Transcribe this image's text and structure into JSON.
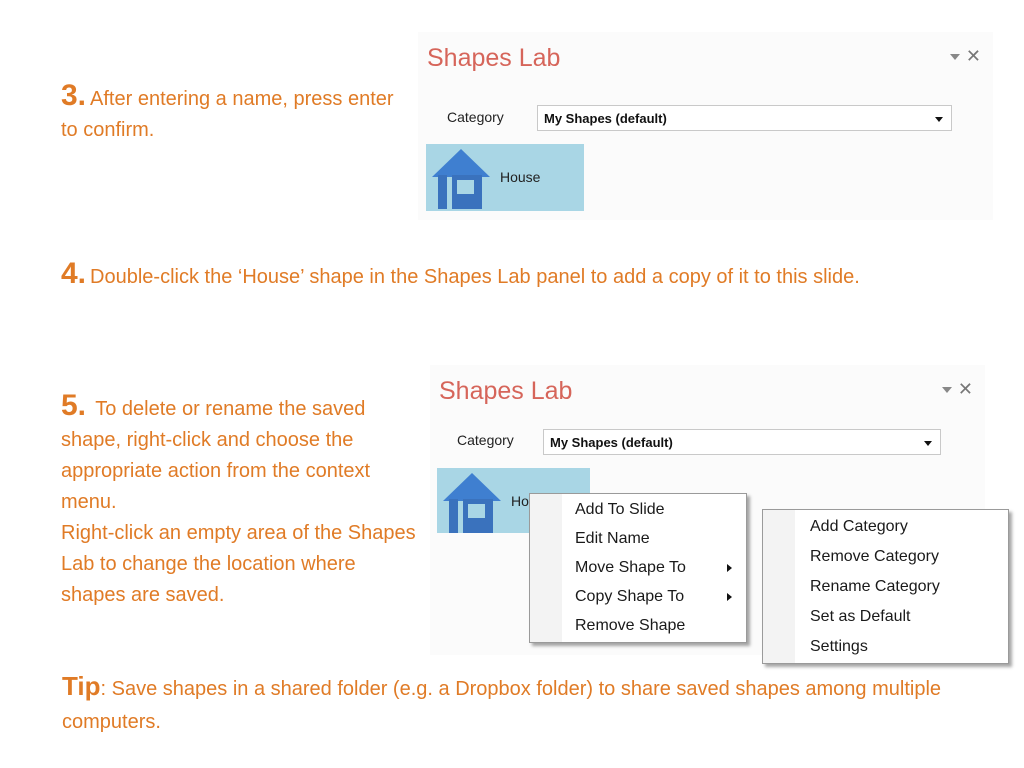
{
  "steps": {
    "step3": {
      "number": "3.",
      "text": "After entering a name, press enter to confirm."
    },
    "step4": {
      "number": "4.",
      "text": "Double-click the ‘House’ shape in the Shapes Lab panel to add a copy of it to this slide."
    },
    "step5": {
      "number": "5.",
      "text": " To delete or rename the saved shape, right-click and choose the appropriate action from the context menu.",
      "text2": "Right-click an empty area of the Shapes Lab to change the location where shapes are saved."
    }
  },
  "tip": {
    "label": "Tip",
    "text": ": Save shapes in a shared folder (e.g. a Dropbox folder) to share saved shapes among multiple computers."
  },
  "panel": {
    "title": "Shapes Lab",
    "category_label": "Category",
    "category_value": "My Shapes (default)",
    "shape_name": "House",
    "shape_name_partial": "Ho",
    "title_color": "#d6655a",
    "tile_color": "#a9d6e5"
  },
  "shape_context_menu": {
    "items": [
      {
        "label": "Add To Slide",
        "submenu": false
      },
      {
        "label": "Edit Name",
        "submenu": false
      },
      {
        "label": "Move Shape To",
        "submenu": true
      },
      {
        "label": "Copy Shape To",
        "submenu": true
      },
      {
        "label": "Remove Shape",
        "submenu": false
      }
    ]
  },
  "panel_context_menu": {
    "items": [
      {
        "label": "Add Category"
      },
      {
        "label": "Remove Category"
      },
      {
        "label": "Rename Category"
      },
      {
        "label": "Set as Default"
      },
      {
        "label": "Settings"
      }
    ]
  },
  "colors": {
    "accent": "#e07b26"
  }
}
